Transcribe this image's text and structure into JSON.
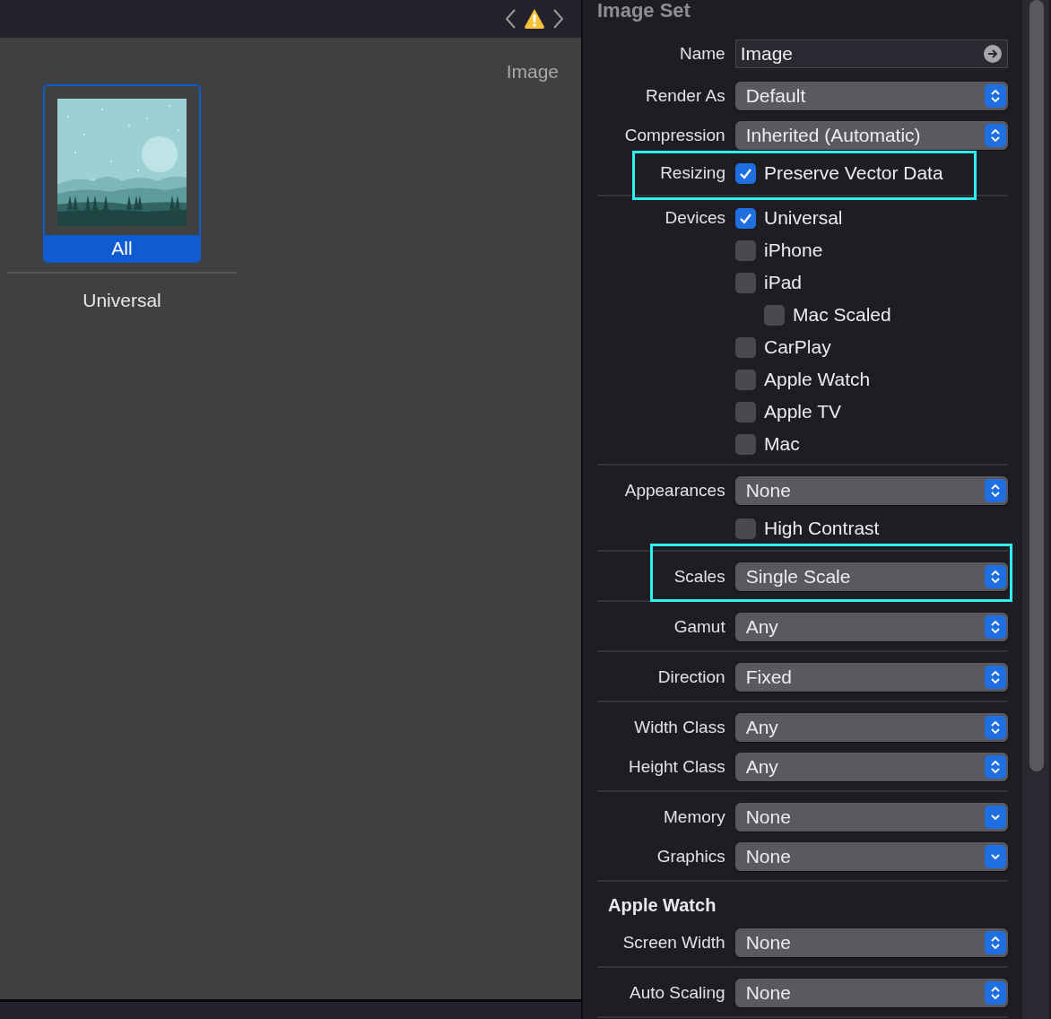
{
  "editor": {
    "nav": {
      "warning": true
    },
    "slot_title": "Image",
    "thumbnail": {
      "label": "All",
      "selected": true
    },
    "group_label": "Universal"
  },
  "inspector": {
    "title": "Image Set",
    "groups": [
      {
        "rows": [
          {
            "kind": "text_field",
            "label": "Name",
            "value": "Image"
          },
          {
            "kind": "popup",
            "label": "Render As",
            "value": "Default"
          },
          {
            "kind": "popup",
            "label": "Compression",
            "value": "Inherited (Automatic)"
          },
          {
            "kind": "checkbox",
            "label": "Resizing",
            "text": "Preserve Vector Data",
            "checked": true,
            "highlighted": true
          }
        ]
      },
      {
        "rows": [
          {
            "kind": "checklist",
            "label": "Devices",
            "items": [
              {
                "text": "Universal",
                "checked": true
              },
              {
                "text": "iPhone",
                "checked": false
              },
              {
                "text": "iPad",
                "checked": false,
                "children": [
                  {
                    "text": "Mac Scaled",
                    "checked": false
                  }
                ]
              },
              {
                "text": "CarPlay",
                "checked": false
              },
              {
                "text": "Apple Watch",
                "checked": false
              },
              {
                "text": "Apple TV",
                "checked": false
              },
              {
                "text": "Mac",
                "checked": false
              }
            ]
          }
        ]
      },
      {
        "rows": [
          {
            "kind": "popup",
            "label": "Appearances",
            "value": "None"
          },
          {
            "kind": "checkbox",
            "text": "High Contrast",
            "checked": false
          }
        ]
      },
      {
        "rows": [
          {
            "kind": "popup",
            "label": "Scales",
            "value": "Single Scale",
            "highlighted": true
          }
        ]
      },
      {
        "rows": [
          {
            "kind": "popup",
            "label": "Gamut",
            "value": "Any"
          }
        ]
      },
      {
        "rows": [
          {
            "kind": "popup",
            "label": "Direction",
            "value": "Fixed"
          }
        ]
      },
      {
        "rows": [
          {
            "kind": "popup",
            "label": "Width Class",
            "value": "Any"
          },
          {
            "kind": "popup",
            "label": "Height Class",
            "value": "Any"
          }
        ]
      },
      {
        "rows": [
          {
            "kind": "pulldown",
            "label": "Memory",
            "value": "None"
          },
          {
            "kind": "pulldown",
            "label": "Graphics",
            "value": "None"
          }
        ]
      },
      {
        "rows": [
          {
            "kind": "heading",
            "text": "Apple Watch"
          },
          {
            "kind": "popup",
            "label": "Screen Width",
            "value": "None"
          }
        ]
      },
      {
        "rows": [
          {
            "kind": "popup",
            "label": "Auto Scaling",
            "value": "None"
          }
        ]
      }
    ]
  }
}
